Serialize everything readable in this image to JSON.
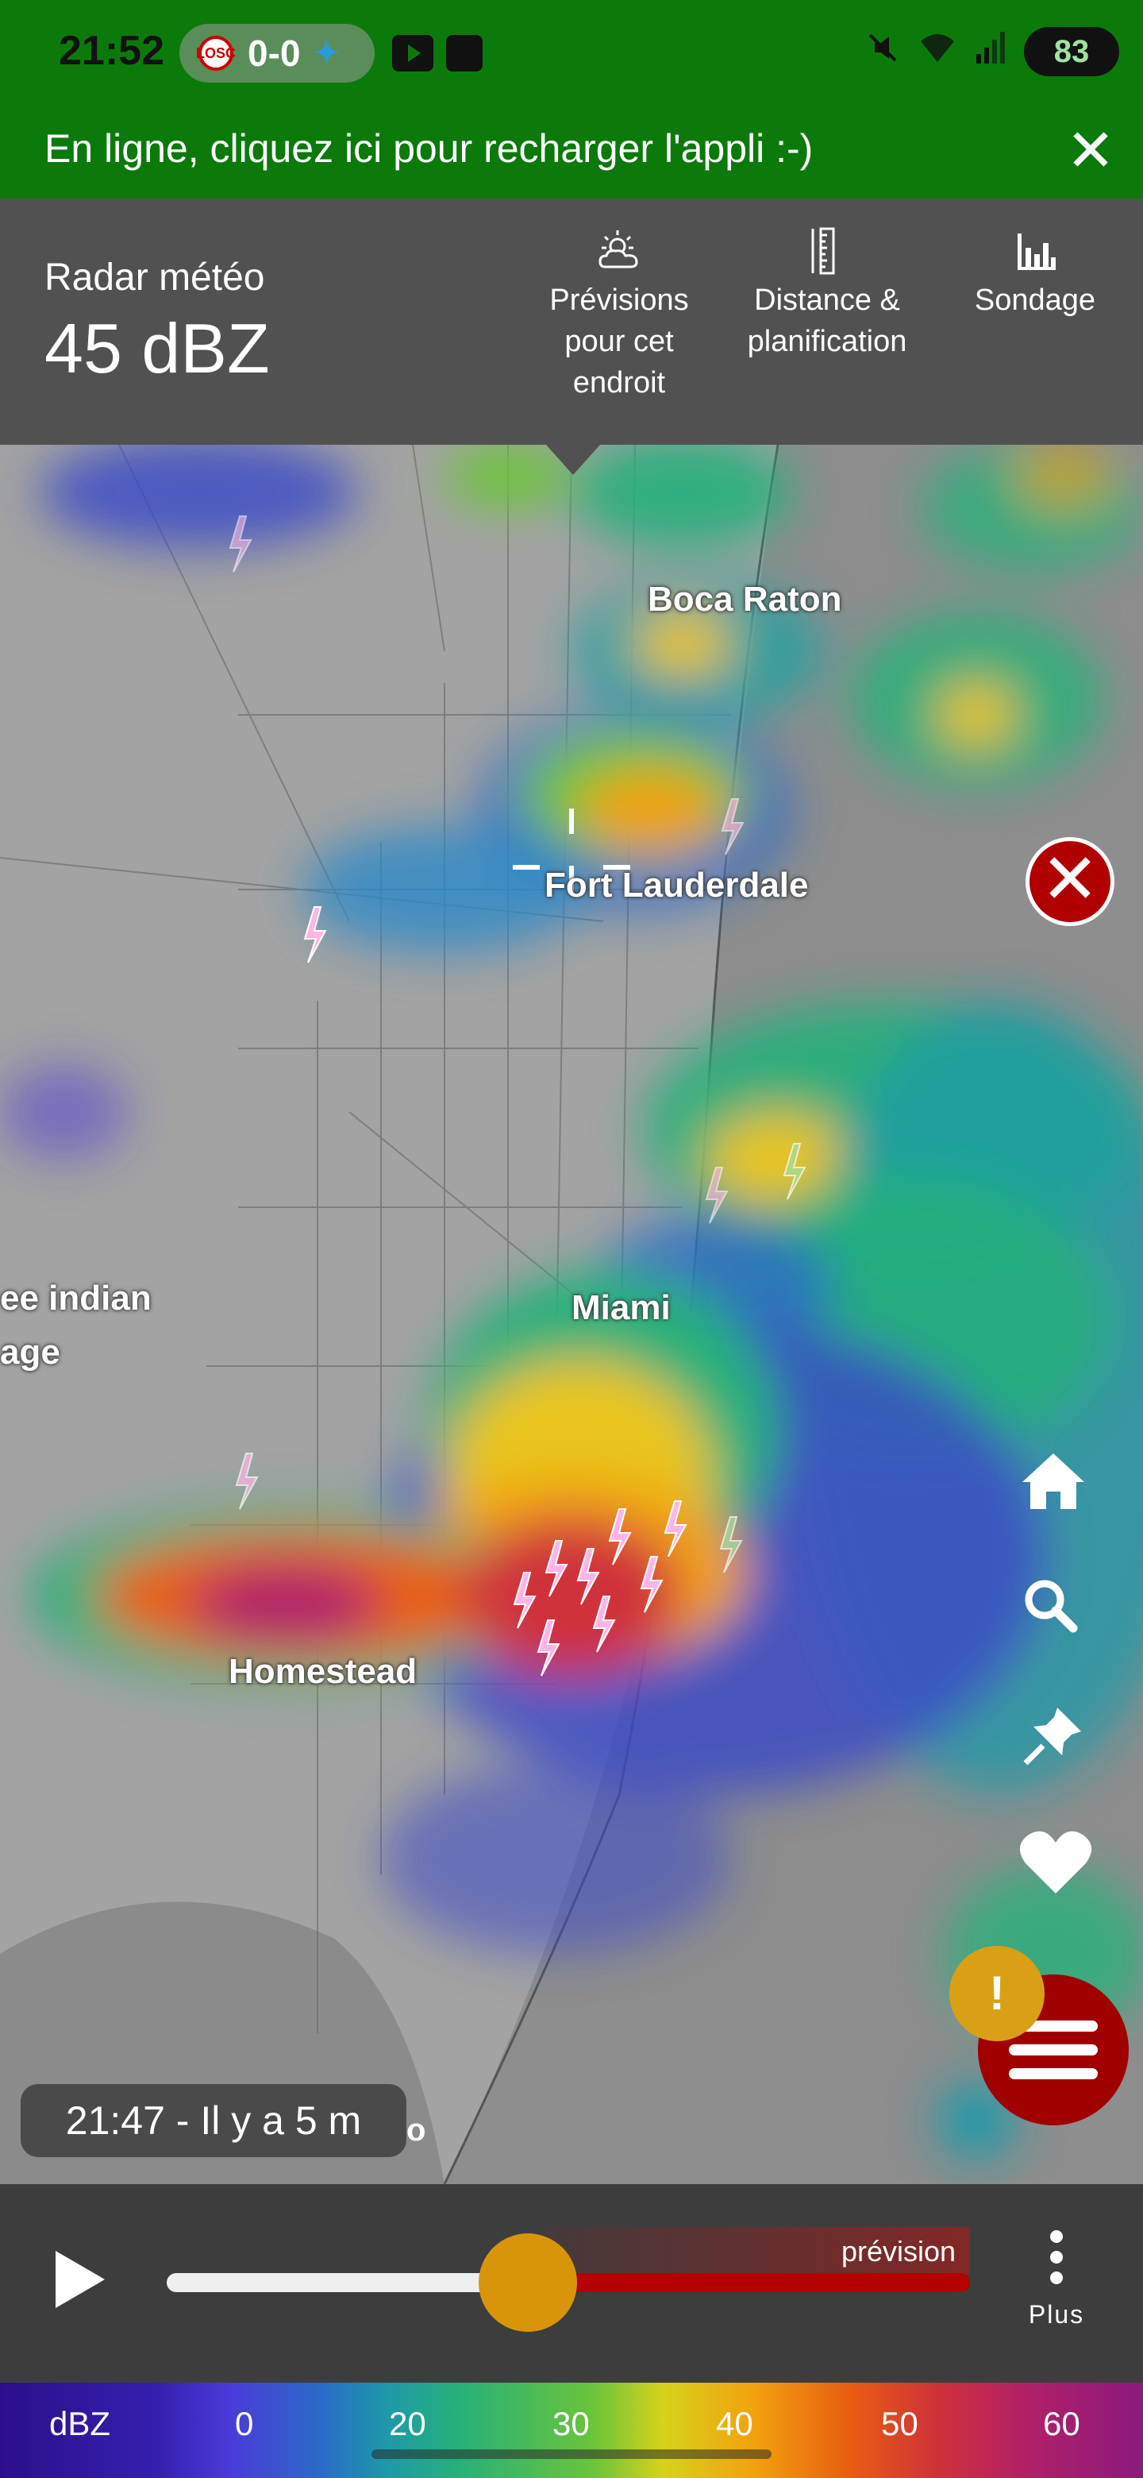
{
  "status_bar": {
    "time": "21:52",
    "score": "0-0",
    "home_team_abbr": "LOSC",
    "away_team_glyph": "✦",
    "battery": "83"
  },
  "banner": {
    "message": "En ligne, cliquez ici pour recharger l'appli :-)",
    "close_glyph": "✕"
  },
  "header": {
    "layer_label": "Radar météo",
    "value": "45 dBZ",
    "actions": [
      {
        "label": "Prévisions pour cet endroit",
        "icon": "sun-cloud-icon"
      },
      {
        "label": "Distance & planification",
        "icon": "ruler-icon"
      },
      {
        "label": "Sondage",
        "icon": "bar-chart-icon"
      }
    ]
  },
  "map": {
    "cities": {
      "boca_raton": "Boca Raton",
      "fort_lauderdale": "Fort Lauderdale",
      "miami": "Miami",
      "homestead": "Homestead",
      "indian_1": "ee indian",
      "indian_2": "age"
    },
    "close_glyph": "✕",
    "time_chip": "21:47 - Il y a 5 m",
    "stray_letter": "o",
    "alert_glyph": "!"
  },
  "timeline": {
    "forecast_label": "prévision",
    "more_label": "Plus",
    "progress": 0.45
  },
  "legend": {
    "unit": "dBZ",
    "ticks": [
      "0",
      "20",
      "30",
      "40",
      "50",
      "60"
    ]
  },
  "colors": {
    "status_green": "#0b7a0b",
    "panel_gray": "#515151",
    "close_red": "#b00000",
    "thumb_orange": "#d9950a",
    "alert_yellow": "#d9a015"
  }
}
